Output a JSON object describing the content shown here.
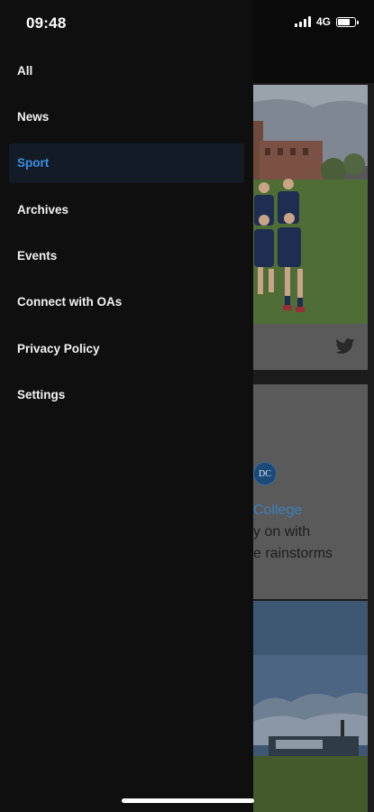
{
  "status_bar": {
    "time": "09:48",
    "network": "4G",
    "battery_level": 0.75
  },
  "drawer": {
    "items": [
      {
        "label": "All",
        "active": false
      },
      {
        "label": "News",
        "active": false
      },
      {
        "label": "Sport",
        "active": true
      },
      {
        "label": "Archives",
        "active": false
      },
      {
        "label": "Events",
        "active": false
      },
      {
        "label": "Connect with OAs",
        "active": false
      },
      {
        "label": "Privacy Policy",
        "active": false
      },
      {
        "label": "Settings",
        "active": false
      }
    ]
  },
  "feed": {
    "card1": {
      "source_icon": "twitter-icon"
    },
    "card2": {
      "badge": "DC",
      "title": "College",
      "text_line1": "y on with",
      "text_line2": "e rainstorms"
    }
  },
  "colors": {
    "drawer_bg": "#0f0f0f",
    "active_bg": "#131c26",
    "active_text": "#3d8fe6",
    "text": "#f2f2f2"
  }
}
